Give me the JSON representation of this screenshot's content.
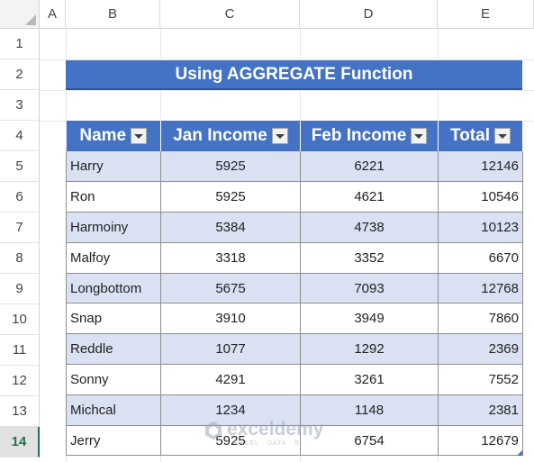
{
  "columns": [
    "A",
    "B",
    "C",
    "D",
    "E"
  ],
  "rows": [
    "1",
    "2",
    "3",
    "4",
    "5",
    "6",
    "7",
    "8",
    "9",
    "10",
    "11",
    "12",
    "13",
    "14"
  ],
  "active_row": "14",
  "title": "Using AGGREGATE Function",
  "table": {
    "headers": [
      "Name",
      "Jan Income",
      "Feb Income",
      "Total"
    ],
    "rows": [
      [
        "Harry",
        "5925",
        "6221",
        "12146"
      ],
      [
        "Ron",
        "5925",
        "4621",
        "10546"
      ],
      [
        "Harmoiny",
        "5384",
        "4738",
        "10123"
      ],
      [
        "Malfoy",
        "3318",
        "3352",
        "6670"
      ],
      [
        "Longbottom",
        "5675",
        "7093",
        "12768"
      ],
      [
        "Snap",
        "3910",
        "3949",
        "7860"
      ],
      [
        "Reddle",
        "1077",
        "1292",
        "2369"
      ],
      [
        "Sonny",
        "4291",
        "3261",
        "7552"
      ],
      [
        "Michcal",
        "1234",
        "1148",
        "2381"
      ],
      [
        "Jerry",
        "5925",
        "6754",
        "12679"
      ]
    ]
  },
  "watermark": {
    "name": "exceldemy",
    "tagline": "EXCEL · DATA · BI"
  },
  "colors": {
    "header_fill": "#4472c4",
    "band_fill": "#d9e1f2",
    "active_row": "#217346"
  }
}
